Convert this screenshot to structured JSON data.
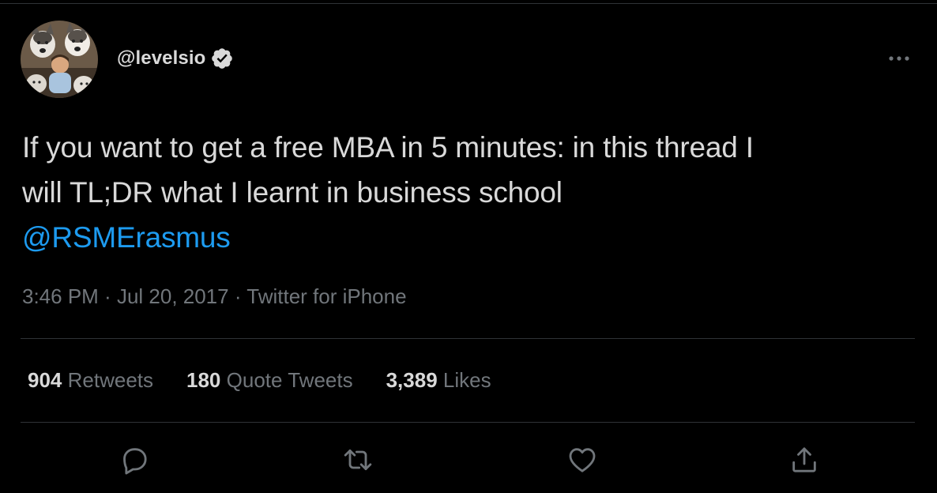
{
  "tweet": {
    "handle": "@levelsio",
    "verified": true,
    "text_lines": [
      "If you want to get a free MBA in 5 minutes: in this thread I",
      "will TL;DR what I learnt in business school"
    ],
    "mention": "@RSMErasmus",
    "time": "3:46 PM",
    "date": "Jul 20, 2017",
    "source": "Twitter for iPhone",
    "separator": " · "
  },
  "stats": {
    "retweets": {
      "count": "904",
      "label": "Retweets"
    },
    "quotes": {
      "count": "180",
      "label": "Quote Tweets"
    },
    "likes": {
      "count": "3,389",
      "label": "Likes"
    }
  },
  "icons": {
    "avatar": "avatar-photo-huskies",
    "verified": "verified-badge-icon",
    "more": "more-horizontal-icon",
    "reply": "reply-icon",
    "retweet": "retweet-icon",
    "like": "heart-icon",
    "share": "share-icon"
  },
  "colors": {
    "background": "#000000",
    "text": "#d9d9d9",
    "secondary": "#71767b",
    "link": "#1d9bf0",
    "divider": "#2f3336"
  }
}
